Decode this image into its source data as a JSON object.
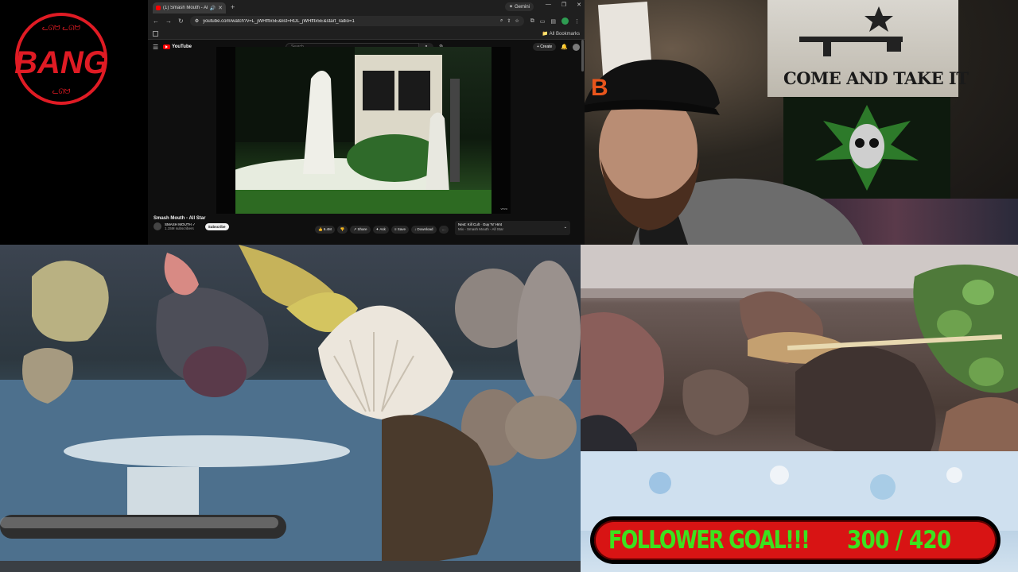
{
  "logo": {
    "text": "BANG",
    "arc_top": "ᓚᘏᗢ ᓚᘏᗢ",
    "arc_bottom": "ᓚᘏᗢ"
  },
  "browser": {
    "tab_title": "(1) Smash Mouth - All Star",
    "new_tab": "+",
    "gemini_label": "Gemini",
    "url": "youtube.com/watch?v=L_jWHffIx5E&list=RDL_jWHffIx5E&start_radio=1",
    "bookmarks_label": "All Bookmarks"
  },
  "youtube": {
    "logo_text": "YouTube",
    "search_placeholder": "Search",
    "create_label": "Create",
    "notification_count": "9+",
    "video_title": "Smash Mouth - All Star",
    "channel_name": "SMASH MOUTH",
    "channel_subs": "1.15M subscribers",
    "subscribe_label": "Subscribe",
    "watermark": "vevo",
    "actions": [
      "6.4M",
      "Share",
      "Ask",
      "Save",
      "Download",
      "…"
    ],
    "next_title": "Next: Kill Cult · Guy 'N' Hmt",
    "next_subtitle": "Mix - Smash Mouth - All Star"
  },
  "webcam": {
    "flag_text": "COME AND TAKE IT"
  },
  "follower_goal": {
    "label": "FOLLOWER GOAL!!!",
    "current": 300,
    "target": 420,
    "display": "300 / 420",
    "fill_fraction": 0.714
  },
  "colors": {
    "goal_bg": "#d81414",
    "goal_text": "#3ce21e",
    "logo_red": "#e01b24",
    "yt_red": "#ff0000"
  }
}
